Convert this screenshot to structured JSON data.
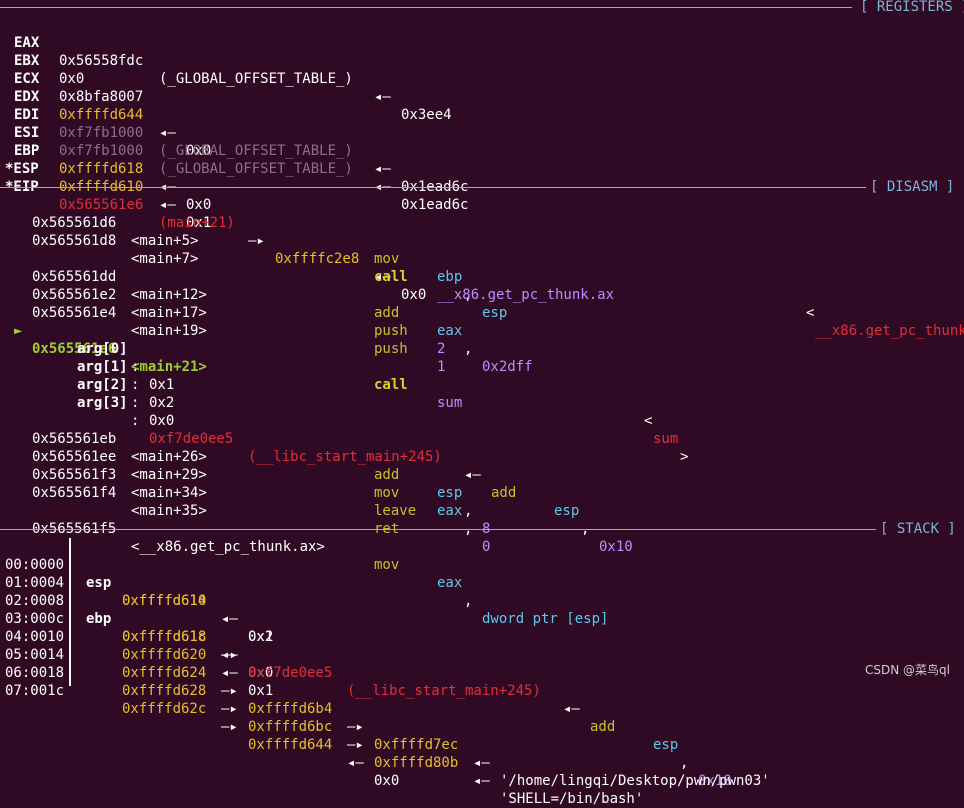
{
  "sections": {
    "registers": "[ REGISTERS ]",
    "disasm": "[ DISASM ]",
    "stack": "[ STACK ]"
  },
  "arrow": "◂—",
  "arrow_r": "—▸",
  "registers": {
    "eax": {
      "name": "EAX",
      "v1": "0x56558fdc",
      "sym": "(_GLOBAL_OFFSET_TABLE_)",
      "v2": "0x3ee4"
    },
    "ebx": {
      "name": "EBX",
      "v1": "0x0"
    },
    "ecx": {
      "name": "ECX",
      "v1": "0x8bfa8007"
    },
    "edx": {
      "name": "EDX",
      "v1": "0xffffd644",
      "v2": "0x0"
    },
    "edi": {
      "name": "EDI",
      "v1": "0xf7fb1000",
      "sym": "(_GLOBAL_OFFSET_TABLE_)",
      "v2": "0x1ead6c"
    },
    "esi": {
      "name": "ESI",
      "v1": "0xf7fb1000",
      "sym": "(_GLOBAL_OFFSET_TABLE_)",
      "v2": "0x1ead6c"
    },
    "ebp": {
      "name": "EBP",
      "v1": "0xffffd618",
      "v2": "0x0"
    },
    "esp": {
      "name": "*ESP",
      "v1": "0xffffd610",
      "v2": "0x1"
    },
    "eip": {
      "name": "*EIP",
      "v1": "0x565561e6",
      "sym": "(main+21)",
      "v2": "0xffffc2e8",
      "v3": "0x0"
    }
  },
  "disasm": {
    "cursor": "►",
    "rows": [
      {
        "addr": "0x565561d6",
        "loc": "<main+5>",
        "op": "mov",
        "a1": "ebp",
        "sep": ",",
        "a2": "esp"
      },
      {
        "addr": "0x565561d8",
        "loc": "<main+7>",
        "op": "call",
        "a1": "__x86.get_pc_thunk.ax",
        "target_pre": "<",
        "target": "__x86.get_pc_thunk"
      },
      {
        "addr": "0x565561dd",
        "loc": "<main+12>",
        "op": "add",
        "a1": "eax",
        "sep": ",",
        "a2": "0x2dff"
      },
      {
        "addr": "0x565561e2",
        "loc": "<main+17>",
        "op": "push",
        "a1": "2"
      },
      {
        "addr": "0x565561e4",
        "loc": "<main+19>",
        "op": "push",
        "a1": "1"
      },
      {
        "addr": "0x565561e6",
        "loc": "<main+21>",
        "op": "call",
        "a1": "sum",
        "target_pre": "<",
        "target": "sum",
        "target_post": ">"
      },
      {
        "addr": "0x565561eb",
        "loc": "<main+26>",
        "op": "add",
        "a1": "esp",
        "sep": ",",
        "a2": "8"
      },
      {
        "addr": "0x565561ee",
        "loc": "<main+29>",
        "op": "mov",
        "a1": "eax",
        "sep": ",",
        "a2": "0"
      },
      {
        "addr": "0x565561f3",
        "loc": "<main+34>",
        "op": "leave"
      },
      {
        "addr": "0x565561f4",
        "loc": "<main+35>",
        "op": "ret"
      },
      {
        "addr": "0x565561f5",
        "loc": "<__x86.get_pc_thunk.ax>",
        "op": "mov",
        "a1": "eax",
        "sep": ",",
        "a2": "dword ptr [esp]"
      }
    ],
    "args": [
      {
        "label": "arg[0]",
        "colon": ":",
        "val": "0x1"
      },
      {
        "label": "arg[1]",
        "colon": ":",
        "val": "0x2"
      },
      {
        "label": "arg[2]",
        "colon": ":",
        "val": "0x0"
      },
      {
        "label": "arg[3]",
        "colon": ":",
        "val": "0xf7de0ee5",
        "sym": "(__libc_start_main+245)",
        "op": "add",
        "a1": "esp",
        "sep": ",",
        "a2": "0x10"
      }
    ]
  },
  "stack": [
    {
      "off": "00:0000",
      "reg": "esp",
      "addr": "0xffffd610",
      "v1": "0x1"
    },
    {
      "off": "01:0004",
      "addr": "0xffffd614",
      "v1": "0x2"
    },
    {
      "off": "02:0008",
      "reg": "ebp",
      "addr": "0xffffd618",
      "v1": "0x0"
    },
    {
      "off": "03:000c",
      "addr": "0xffffd61c",
      "v1": "0xf7de0ee5",
      "sym": "(__libc_start_main+245)",
      "op": "add",
      "a1": "esp",
      "sep": ",",
      "a2": "0x10"
    },
    {
      "off": "04:0010",
      "addr": "0xffffd620",
      "v1": "0x1"
    },
    {
      "off": "05:0014",
      "addr": "0xffffd624",
      "v1": "0xffffd6b4",
      "v2": "0xffffd7ec",
      "str": "'/home/lingqi/Desktop/pwn/pwn03'"
    },
    {
      "off": "06:0018",
      "addr": "0xffffd628",
      "v1": "0xffffd6bc",
      "v2": "0xffffd80b",
      "str": "'SHELL=/bin/bash'"
    },
    {
      "off": "07:001c",
      "addr": "0xffffd62c",
      "v1": "0xffffd644",
      "v2": "0x0"
    }
  ],
  "watermark": "CSDN @菜鸟ql",
  "colors": {
    "background": "#300a24",
    "rule": "#7bb6d8",
    "yellow": "#e7bf2e",
    "red": "#e22e3a",
    "cyan": "#5fc8e8",
    "purple": "#b591ff",
    "green": "#9bd02e"
  }
}
